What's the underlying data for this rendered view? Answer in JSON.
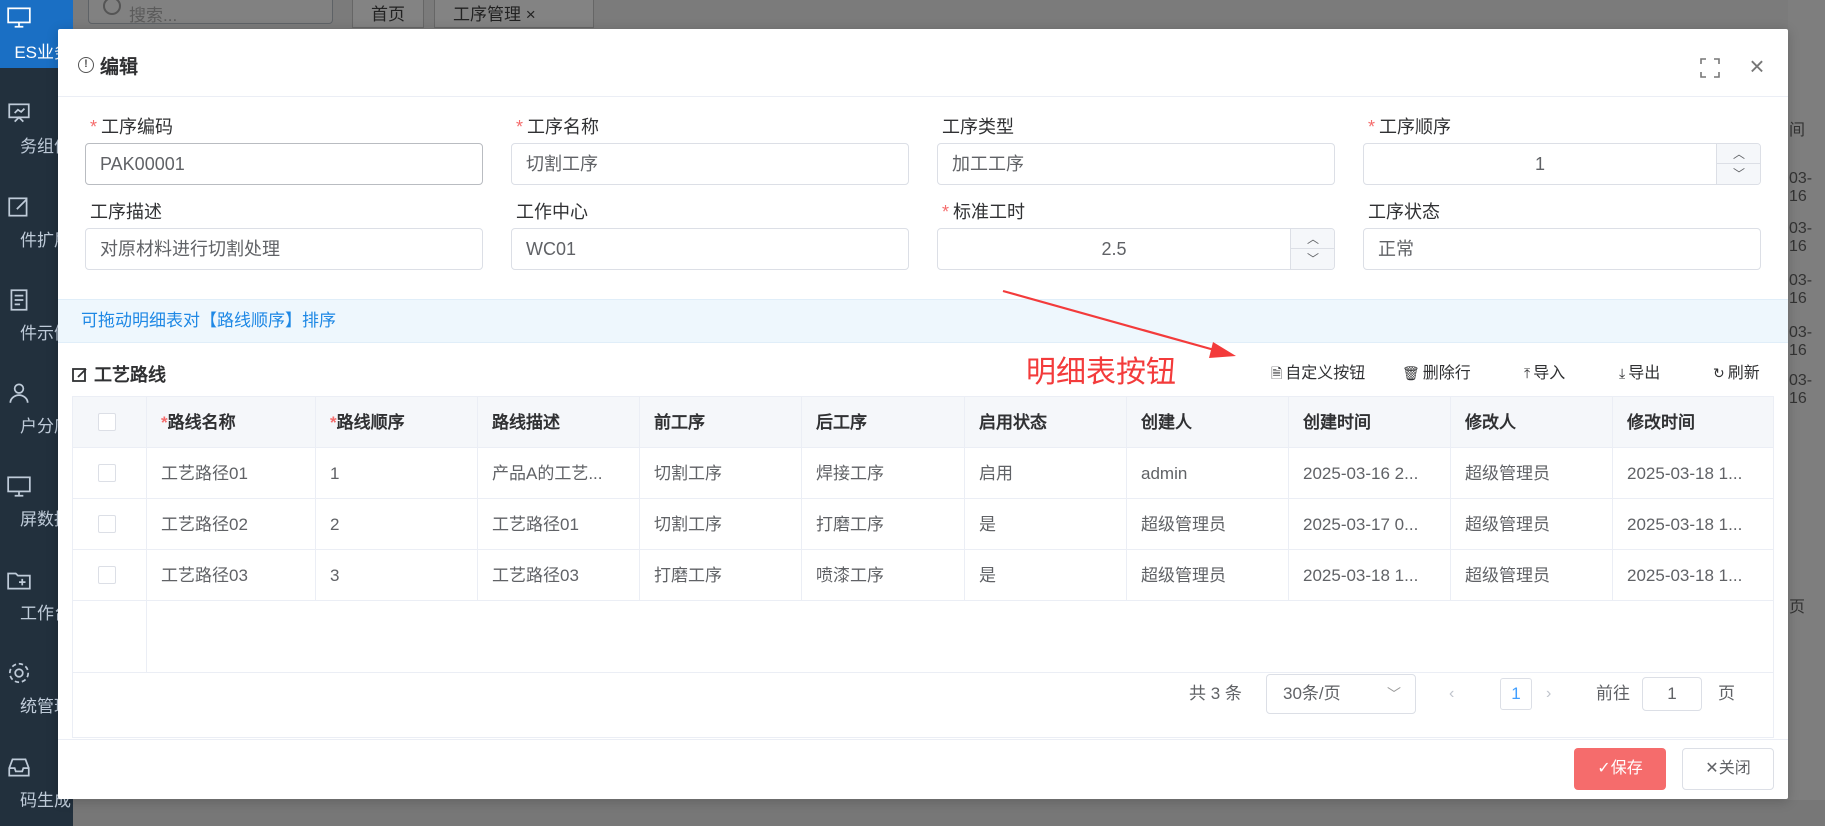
{
  "background": {
    "search_placeholder": "搜索...",
    "tabs": [
      "首页",
      "工序管理"
    ],
    "sidebar": [
      {
        "label": "ES业务",
        "icon": "monitor-icon",
        "active": true
      },
      {
        "label": "务组件",
        "icon": "presentation-icon"
      },
      {
        "label": "件扩展",
        "icon": "edit-icon"
      },
      {
        "label": "件示例",
        "icon": "document-icon"
      },
      {
        "label": "户分库",
        "icon": "user-icon"
      },
      {
        "label": "屏数据",
        "icon": "monitor-icon"
      },
      {
        "label": "工作台",
        "icon": "folder-add-icon"
      },
      {
        "label": "统管理",
        "icon": "gear-icon"
      },
      {
        "label": "码生成",
        "icon": "inbox-icon"
      }
    ],
    "right_partial": [
      "间",
      "03-16",
      "03-16",
      "03-16",
      "03-16",
      "03-16",
      "页"
    ]
  },
  "dialog": {
    "title": "编辑",
    "form": {
      "process_code": {
        "label": "工序编码",
        "value": "PAK00001",
        "required": true
      },
      "process_name": {
        "label": "工序名称",
        "value": "切割工序",
        "required": true
      },
      "process_type": {
        "label": "工序类型",
        "value": "加工工序",
        "required": false
      },
      "process_order": {
        "label": "工序顺序",
        "value": "1",
        "required": true
      },
      "process_desc": {
        "label": "工序描述",
        "value": "对原材料进行切割处理",
        "required": false
      },
      "work_center": {
        "label": "工作中心",
        "value": "WC01",
        "required": false
      },
      "std_hours": {
        "label": "标准工时",
        "value": "2.5",
        "required": true
      },
      "process_status": {
        "label": "工序状态",
        "value": "正常",
        "required": false
      }
    },
    "tip": "可拖动明细表对【路线顺序】排序",
    "annotation": "明细表按钮",
    "detail": {
      "title": "工艺路线",
      "toolbar": [
        "自定义按钮",
        "删除行",
        "导入",
        "导出",
        "刷新"
      ],
      "columns": [
        "路线名称",
        "路线顺序",
        "路线描述",
        "前工序",
        "后工序",
        "启用状态",
        "创建人",
        "创建时间",
        "修改人",
        "修改时间"
      ],
      "rows": [
        [
          "工艺路径01",
          "1",
          "产品A的工艺...",
          "切割工序",
          "焊接工序",
          "启用",
          "admin",
          "2025-03-16 2...",
          "超级管理员",
          "2025-03-18 1..."
        ],
        [
          "工艺路径02",
          "2",
          "工艺路径01",
          "切割工序",
          "打磨工序",
          "是",
          "超级管理员",
          "2025-03-17 0...",
          "超级管理员",
          "2025-03-18 1..."
        ],
        [
          "工艺路径03",
          "3",
          "工艺路径03",
          "打磨工序",
          "喷漆工序",
          "是",
          "超级管理员",
          "2025-03-18 1...",
          "超级管理员",
          "2025-03-18 1..."
        ]
      ]
    },
    "pagination": {
      "total": "共 3 条",
      "page_size": "30条/页",
      "current_page": "1",
      "goto_label": "前往",
      "goto_value": "1",
      "page_unit": "页"
    },
    "buttons": {
      "save": "保存",
      "close": "关闭"
    }
  },
  "colors": {
    "accent": "#409eff",
    "danger": "#f56c6c",
    "tip_text": "#1e88e5",
    "annotation": "#f33b3b",
    "sidebar_bg": "#22303d"
  }
}
